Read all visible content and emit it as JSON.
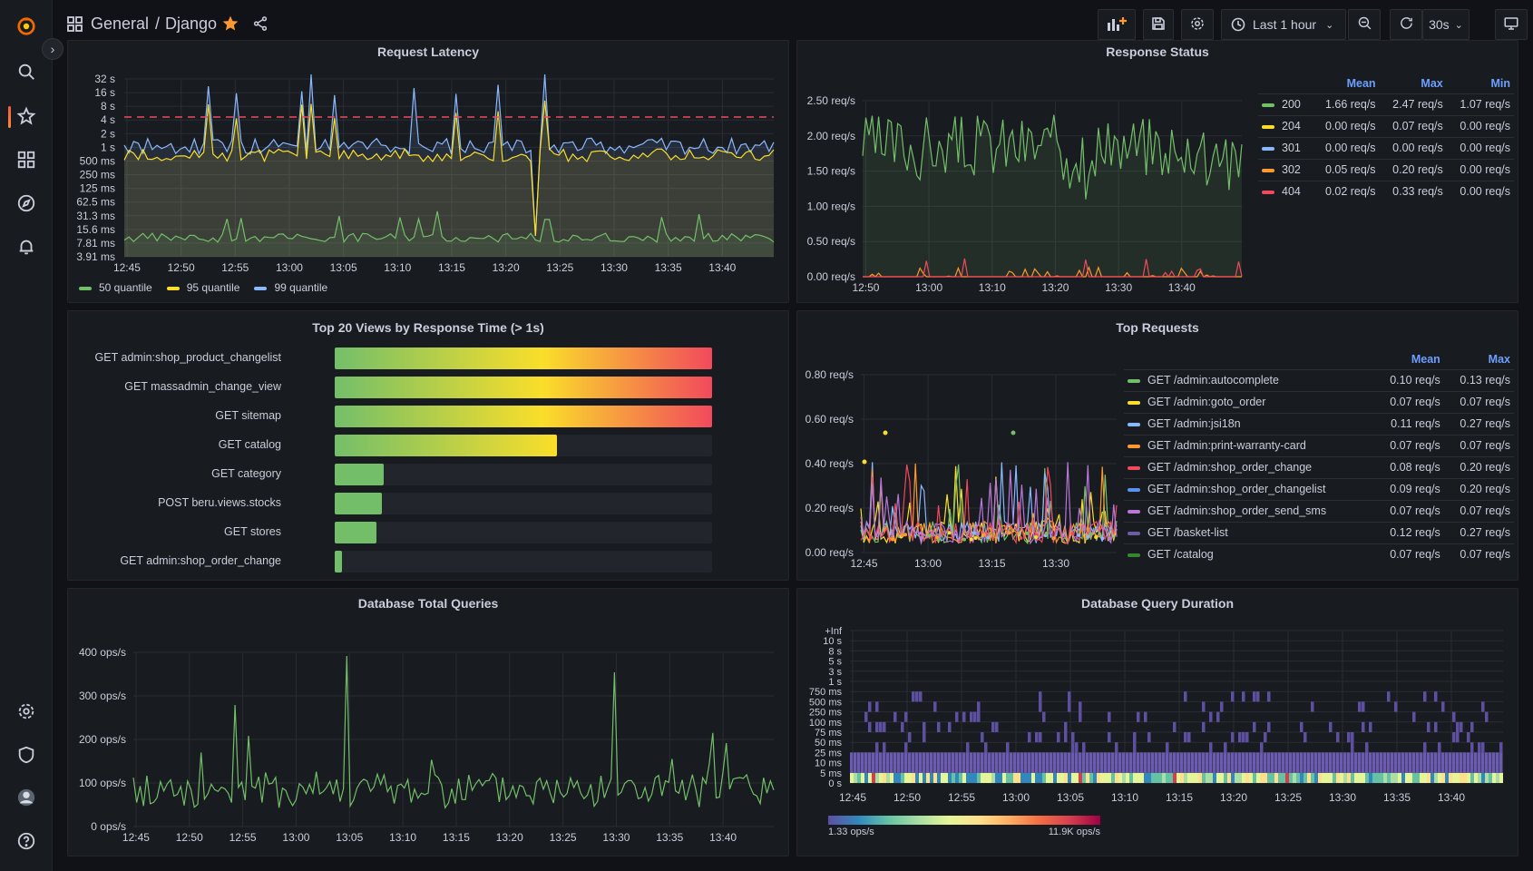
{
  "topbar": {
    "folder": "General",
    "separator": "/",
    "dashboard": "Django",
    "time_range": "Last 1 hour",
    "refresh_interval": "30s"
  },
  "panels": {
    "request_latency": {
      "title": "Request Latency",
      "y_ticks": [
        "32 s",
        "16 s",
        "8 s",
        "4 s",
        "2 s",
        "1 s",
        "500 ms",
        "250 ms",
        "125 ms",
        "62.5 ms",
        "31.3 ms",
        "15.6 ms",
        "7.81 ms",
        "3.91 ms"
      ],
      "x_ticks": [
        "12:45",
        "12:50",
        "12:55",
        "13:00",
        "13:05",
        "13:10",
        "13:15",
        "13:20",
        "13:25",
        "13:30",
        "13:35",
        "13:40"
      ],
      "legend": [
        {
          "name": "50 quantile",
          "color": "#73bf69"
        },
        {
          "name": "95 quantile",
          "color": "#fade2a"
        },
        {
          "name": "99 quantile",
          "color": "#8ab8ff"
        }
      ]
    },
    "response_status": {
      "title": "Response Status",
      "y_ticks": [
        "2.50 req/s",
        "2.00 req/s",
        "1.50 req/s",
        "1.00 req/s",
        "0.50 req/s",
        "0.00 req/s"
      ],
      "x_ticks": [
        "12:50",
        "13:00",
        "13:10",
        "13:20",
        "13:30",
        "13:40"
      ],
      "legend_headers": [
        "Mean",
        "Max",
        "Min"
      ],
      "legend": [
        {
          "name": "200",
          "color": "#73bf69",
          "mean": "1.66 req/s",
          "max": "2.47 req/s",
          "min": "1.07 req/s"
        },
        {
          "name": "204",
          "color": "#fade2a",
          "mean": "0.00 req/s",
          "max": "0.07 req/s",
          "min": "0.00 req/s"
        },
        {
          "name": "301",
          "color": "#8ab8ff",
          "mean": "0.00 req/s",
          "max": "0.00 req/s",
          "min": "0.00 req/s"
        },
        {
          "name": "302",
          "color": "#ff9830",
          "mean": "0.05 req/s",
          "max": "0.20 req/s",
          "min": "0.00 req/s"
        },
        {
          "name": "404",
          "color": "#f2495c",
          "mean": "0.02 req/s",
          "max": "0.33 req/s",
          "min": "0.00 req/s"
        }
      ]
    },
    "top_views": {
      "title": "Top 20 Views by Response Time (> 1s)",
      "rows": [
        {
          "label": "GET admin:shop_product_changelist",
          "value": "100",
          "fraction": 1.0,
          "color": "#f2495c"
        },
        {
          "label": "GET massadmin_change_view",
          "value": "100",
          "fraction": 1.0,
          "color": "#f2495c"
        },
        {
          "label": "GET sitemap",
          "value": "100",
          "fraction": 1.0,
          "color": "#f2495c"
        },
        {
          "label": "GET catalog",
          "value": "59",
          "fraction": 0.59,
          "color": "#fade2a"
        },
        {
          "label": "GET category",
          "value": "13",
          "fraction": 0.13,
          "color": "#73bf69"
        },
        {
          "label": "POST beru.views.stocks",
          "value": "13",
          "fraction": 0.125,
          "color": "#73bf69"
        },
        {
          "label": "GET stores",
          "value": "11",
          "fraction": 0.11,
          "color": "#73bf69"
        },
        {
          "label": "GET admin:shop_order_change",
          "value": "2",
          "fraction": 0.02,
          "color": "#73bf69"
        }
      ],
      "unit": "%"
    },
    "top_requests": {
      "title": "Top Requests",
      "y_ticks": [
        "0.80 req/s",
        "0.60 req/s",
        "0.40 req/s",
        "0.20 req/s",
        "0.00 req/s"
      ],
      "x_ticks": [
        "12:45",
        "13:00",
        "13:15",
        "13:30"
      ],
      "legend_headers": [
        "Mean",
        "Max"
      ],
      "legend": [
        {
          "name": "GET /admin:autocomplete",
          "color": "#73bf69",
          "mean": "0.10 req/s",
          "max": "0.13 req/s"
        },
        {
          "name": "GET /admin:goto_order",
          "color": "#fade2a",
          "mean": "0.07 req/s",
          "max": "0.07 req/s"
        },
        {
          "name": "GET /admin:jsi18n",
          "color": "#8ab8ff",
          "mean": "0.11 req/s",
          "max": "0.27 req/s"
        },
        {
          "name": "GET /admin:print-warranty-card",
          "color": "#ff9830",
          "mean": "0.07 req/s",
          "max": "0.07 req/s"
        },
        {
          "name": "GET /admin:shop_order_change",
          "color": "#f2495c",
          "mean": "0.08 req/s",
          "max": "0.20 req/s"
        },
        {
          "name": "GET /admin:shop_order_changelist",
          "color": "#5794f2",
          "mean": "0.09 req/s",
          "max": "0.20 req/s"
        },
        {
          "name": "GET /admin:shop_order_send_sms",
          "color": "#b877d9",
          "mean": "0.07 req/s",
          "max": "0.07 req/s"
        },
        {
          "name": "GET /basket-list",
          "color": "#705da0",
          "mean": "0.12 req/s",
          "max": "0.27 req/s"
        },
        {
          "name": "GET /catalog",
          "color": "#37872d",
          "mean": "0.07 req/s",
          "max": "0.07 req/s"
        }
      ]
    },
    "db_total_queries": {
      "title": "Database Total Queries",
      "y_ticks": [
        "400 ops/s",
        "300 ops/s",
        "200 ops/s",
        "100 ops/s",
        "0 ops/s"
      ],
      "x_ticks": [
        "12:45",
        "12:50",
        "12:55",
        "13:00",
        "13:05",
        "13:10",
        "13:15",
        "13:20",
        "13:25",
        "13:30",
        "13:35",
        "13:40"
      ]
    },
    "db_query_duration": {
      "title": "Database Query Duration",
      "y_ticks": [
        "+Inf",
        "10 s",
        "8 s",
        "5 s",
        "3 s",
        "1 s",
        "750 ms",
        "500 ms",
        "250 ms",
        "100 ms",
        "75 ms",
        "50 ms",
        "25 ms",
        "10 ms",
        "5 ms",
        "0 s"
      ],
      "x_ticks": [
        "12:45",
        "12:50",
        "12:55",
        "13:00",
        "13:05",
        "13:10",
        "13:15",
        "13:20",
        "13:25",
        "13:30",
        "13:35",
        "13:40"
      ],
      "scale_min": "1.33 ops/s",
      "scale_max": "11.9K ops/s"
    }
  },
  "chart_data": [
    {
      "type": "line",
      "title": "Request Latency",
      "x": [
        "12:45",
        "13:40"
      ],
      "series": [
        {
          "name": "50 quantile"
        },
        {
          "name": "95 quantile"
        },
        {
          "name": "99 quantile"
        }
      ],
      "ylim": [
        "3.91 ms",
        "32 s"
      ],
      "threshold": "4 s"
    },
    {
      "type": "line",
      "title": "Response Status",
      "series": [
        {
          "name": "200",
          "values_range": [
            1.07,
            2.47
          ]
        }
      ],
      "ylim": [
        0,
        2.5
      ]
    },
    {
      "type": "bar",
      "title": "Top 20 Views by Response Time (> 1s)",
      "categories": [
        "GET admin:shop_product_changelist",
        "GET massadmin_change_view",
        "GET sitemap",
        "GET catalog",
        "GET category",
        "POST beru.views.stocks",
        "GET stores",
        "GET admin:shop_order_change"
      ],
      "values": [
        100,
        100,
        100,
        59,
        13,
        13,
        11,
        2
      ]
    },
    {
      "type": "line",
      "title": "Top Requests",
      "ylim": [
        0,
        0.8
      ]
    },
    {
      "type": "line",
      "title": "Database Total Queries",
      "ylim": [
        0,
        400
      ]
    },
    {
      "type": "heatmap",
      "title": "Database Query Duration"
    }
  ]
}
